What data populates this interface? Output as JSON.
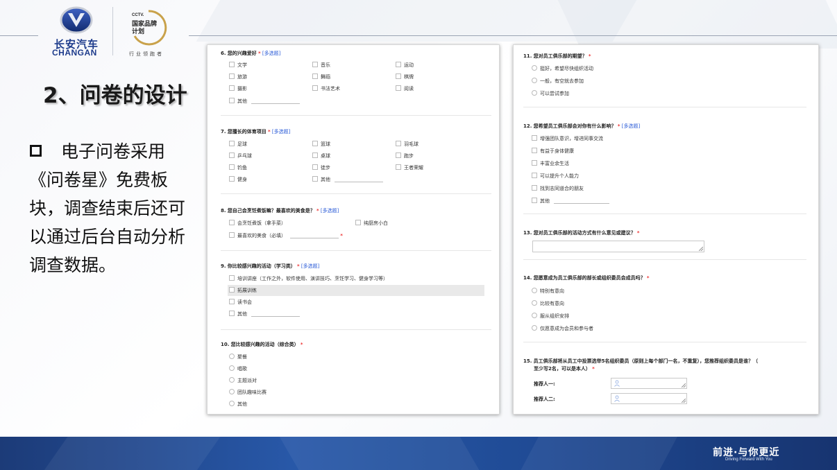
{
  "header": {
    "brand_cn": "长安汽车",
    "brand_en": "CHANGAN",
    "cctv_tag": "CCTV.",
    "cctv_line1": "国家品牌",
    "cctv_line2": "计划",
    "cctv_sub": "行业领跑者"
  },
  "slide": {
    "title": "2、问卷的设计",
    "bullet_line1": "电子问卷采用",
    "bullet_rest": "《问卷星》免费板块，调查结束后还可以通过后台自动分析调查数据。"
  },
  "survey_left": {
    "q6": {
      "num": "6.",
      "text": "您的兴趣爱好",
      "req": "*",
      "multi": "[多选题]",
      "options": [
        "文学",
        "音乐",
        "运动",
        "旅游",
        "舞蹈",
        "棋牌",
        "摄影",
        "书法艺术",
        "阅读",
        "其他"
      ]
    },
    "q7": {
      "num": "7.",
      "text": "您擅长的体育项目",
      "req": "*",
      "multi": "[多选题]",
      "options": [
        "足球",
        "篮球",
        "羽毛球",
        "乒乓球",
        "桌球",
        "跑步",
        "钓鱼",
        "徒步",
        "王者荣耀",
        "健身",
        "其他"
      ]
    },
    "q8": {
      "num": "8.",
      "text": "您自己会烹饪煮饭嘛？最喜欢的美食是？",
      "req": "*",
      "multi": "[多选题]",
      "options": [
        "会烹饪煮饭（拿手菜）",
        "纯厨房小白",
        "最喜欢的美食（必填）"
      ],
      "inline_req": "*"
    },
    "q9": {
      "num": "9.",
      "text": "你比较感兴趣的活动（学习类）",
      "req": "*",
      "multi": "[多选题]",
      "options": [
        "培训讲座（工作之外，软件使用、演讲技巧、烹饪学习、健身学习等）",
        "拓展训练",
        "读书会",
        "其他"
      ]
    },
    "q10": {
      "num": "10.",
      "text": "您比较感兴趣的活动（综合类）",
      "req": "*",
      "options": [
        "聚餐",
        "唱歌",
        "主题派对",
        "团队趣味比赛",
        "其他"
      ]
    }
  },
  "survey_right": {
    "q11": {
      "num": "11.",
      "text": "您对员工俱乐部的期望？",
      "req": "*",
      "options": [
        "挺好，希望尽快组织活动",
        "一般，有空就去参加",
        "可以尝试参加"
      ]
    },
    "q12": {
      "num": "12.",
      "text": "您希望员工俱乐部会对你有什么影响？",
      "req": "*",
      "multi": "[多选题]",
      "options": [
        "增强团队意识，增进同事交流",
        "有益于身体健康",
        "丰富业余生活",
        "可以提升个人能力",
        "找到志同道合的朋友",
        "其他"
      ]
    },
    "q13": {
      "num": "13.",
      "text": "您对员工俱乐部的活动方式有什么意见或建议？",
      "req": "*"
    },
    "q14": {
      "num": "14.",
      "text": "您愿意成为员工俱乐部的部长或组织委员会成员吗？",
      "req": "*",
      "options": [
        "特别有意向",
        "比较有意向",
        "服从组织安排",
        "仅愿意成为会员和参与者"
      ]
    },
    "q15": {
      "num": "15.",
      "text_line1": "员工俱乐部将从员工中投票选举5名组织委员（原则上每个部门一名，不重复），您推荐组织委员是谁？（",
      "text_line2": "至少写2名，可以是本人）",
      "req": "*",
      "fields": [
        "推荐人一:",
        "推荐人二:"
      ]
    }
  },
  "footer": {
    "slogan": "前进·与你更近",
    "slogan_en": "Driving Forward With You"
  },
  "colors": {
    "brand_blue": "#1e3c8c",
    "required_red": "#e33333",
    "multi_blue": "#2a5bd7",
    "footer_blue": "#2858a8"
  }
}
